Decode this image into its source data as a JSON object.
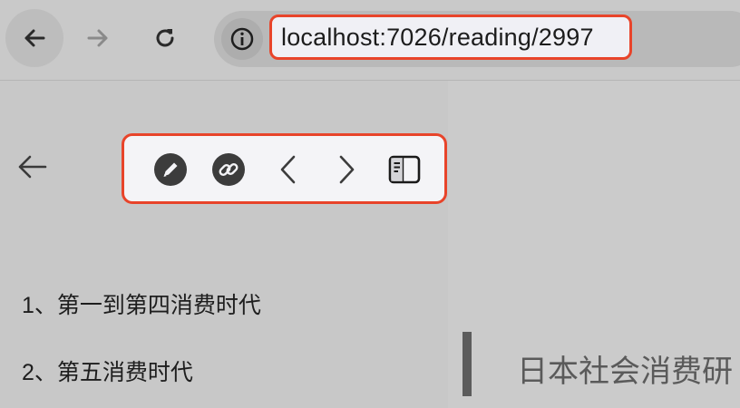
{
  "browser": {
    "url": "localhost:7026/reading/2997"
  },
  "toolbar": {
    "icons": [
      "pencil-icon",
      "link-icon",
      "chevron-left-icon",
      "chevron-right-icon",
      "sidebar-panel-icon"
    ]
  },
  "toc": {
    "items": [
      {
        "label": "1、第一到第四消费时代"
      },
      {
        "label": "2、第五消费时代"
      }
    ]
  },
  "content": {
    "heading": "日本社会消费研"
  },
  "colors": {
    "highlight": "#e8442a",
    "icon": "#3c3c3c"
  }
}
